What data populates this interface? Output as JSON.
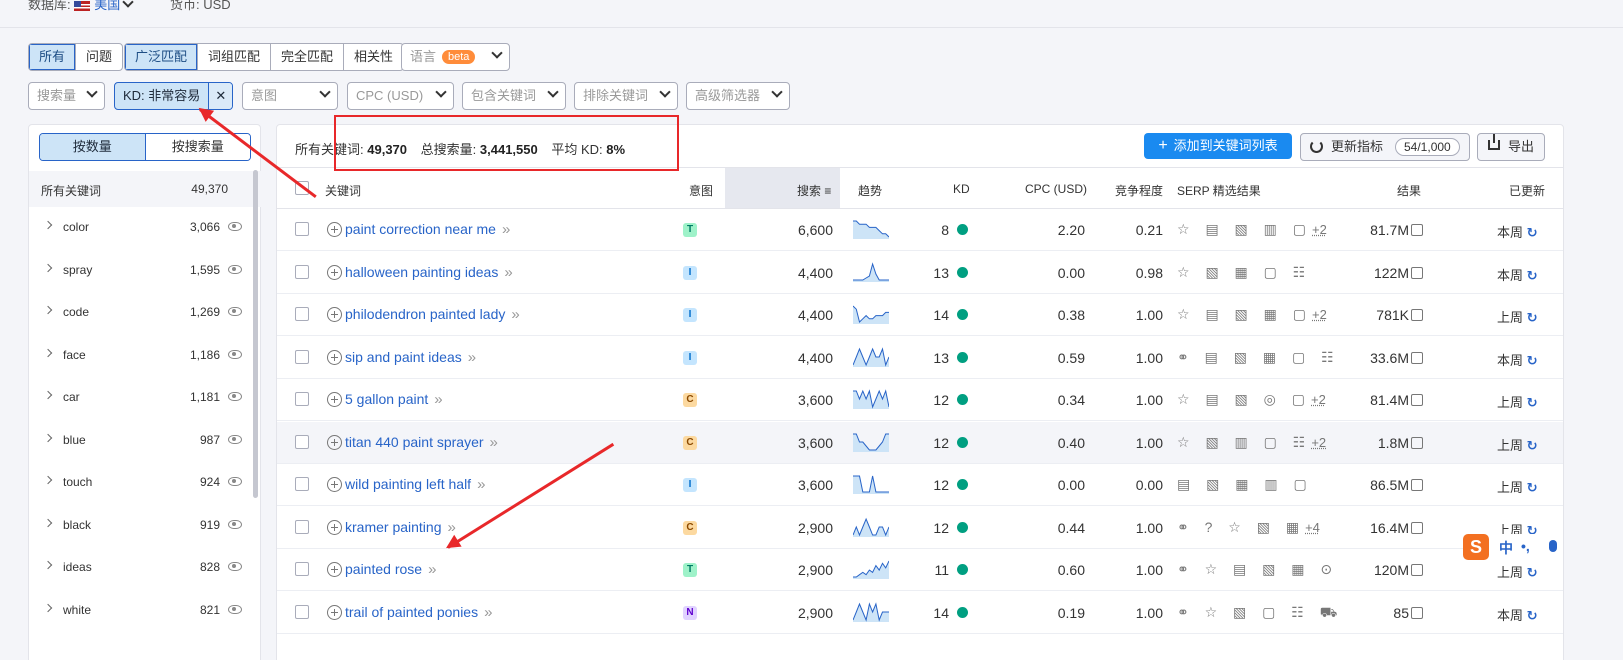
{
  "topbar": {
    "db_label": "数据库:",
    "db_value": "美国",
    "currency": "货币: USD"
  },
  "filters": {
    "type_tabs": [
      "所有",
      "问题"
    ],
    "match_tabs": [
      "广泛匹配",
      "词组匹配",
      "完全匹配",
      "相关性"
    ],
    "language_label": "语言",
    "language_badge": "beta",
    "volume": "搜索量",
    "kd_chip": "KD: 非常容易",
    "intent": "意图",
    "cpc": "CPC (USD)",
    "include": "包含关键词",
    "exclude": "排除关键词",
    "advanced": "高级筛选器"
  },
  "left_panel": {
    "toggle": [
      "按数量",
      "按搜索量"
    ],
    "header_label": "所有关键词",
    "header_count": "49,370",
    "groups": [
      {
        "label": "color",
        "count": "3,066"
      },
      {
        "label": "spray",
        "count": "1,595"
      },
      {
        "label": "code",
        "count": "1,269"
      },
      {
        "label": "face",
        "count": "1,186"
      },
      {
        "label": "car",
        "count": "1,181"
      },
      {
        "label": "blue",
        "count": "987"
      },
      {
        "label": "touch",
        "count": "924"
      },
      {
        "label": "black",
        "count": "919"
      },
      {
        "label": "ideas",
        "count": "828"
      },
      {
        "label": "white",
        "count": "821"
      }
    ]
  },
  "summary": {
    "all_label": "所有关键词:",
    "all_value": "49,370",
    "vol_label": "总搜索量:",
    "vol_value": "3,441,550",
    "kd_label": "平均 KD:",
    "kd_value": "8%"
  },
  "actions": {
    "add": "添加到关键词列表",
    "update": "更新指标",
    "update_count": "54/1,000",
    "export": "导出"
  },
  "table": {
    "headers": {
      "keyword": "关键词",
      "intent": "意图",
      "volume": "搜索",
      "trend": "趋势",
      "kd": "KD",
      "cpc": "CPC (USD)",
      "competition": "竞争程度",
      "serp": "SERP 精选结果",
      "results": "结果",
      "updated": "已更新"
    },
    "rows": [
      {
        "keyword": "paint correction near me",
        "intent": "T",
        "volume": "6,600",
        "kd": "8",
        "cpc": "2.20",
        "com": "0.21",
        "serp": "☆ ▤ ▧ ▥ ▢",
        "more": "+2",
        "results": "81.7M",
        "updated": "本周",
        "trend": [
          8,
          8,
          7,
          7,
          7,
          6,
          6,
          6,
          5,
          4,
          4,
          3
        ]
      },
      {
        "keyword": "halloween painting ideas",
        "intent": "I",
        "volume": "4,400",
        "kd": "13",
        "cpc": "0.00",
        "com": "0.98",
        "serp": "☆ ▧ ▦ ▢ ☷",
        "more": "",
        "results": "122M",
        "updated": "本周",
        "trend": [
          1,
          1,
          1,
          1,
          2,
          3,
          9,
          4,
          1,
          1,
          1,
          1
        ]
      },
      {
        "keyword": "philodendron painted lady",
        "intent": "I",
        "volume": "4,400",
        "kd": "14",
        "cpc": "0.38",
        "com": "1.00",
        "serp": "☆ ▤ ▧ ▦ ▢",
        "more": "+2",
        "results": "781K",
        "updated": "上周",
        "trend": [
          9,
          8,
          4,
          5,
          6,
          5,
          5,
          6,
          6,
          6,
          7,
          7
        ]
      },
      {
        "keyword": "sip and paint ideas",
        "intent": "I",
        "volume": "4,400",
        "kd": "13",
        "cpc": "0.59",
        "com": "1.00",
        "serp": "⚭ ▤ ▧ ▦ ▢ ☷",
        "more": "",
        "results": "33.6M",
        "updated": "本周",
        "trend": [
          4,
          5,
          6,
          5,
          4,
          5,
          6,
          5,
          5,
          6,
          4,
          5
        ]
      },
      {
        "keyword": "5 gallon paint",
        "intent": "C",
        "volume": "3,600",
        "kd": "12",
        "cpc": "0.34",
        "com": "1.00",
        "serp": "☆ ▤ ▧ ◎ ▢",
        "more": "+2",
        "results": "81.4M",
        "updated": "上周",
        "trend": [
          8,
          8,
          7,
          8,
          7,
          8,
          6,
          7,
          8,
          7,
          8,
          6
        ]
      },
      {
        "keyword": "titan 440 paint sprayer",
        "intent": "C",
        "volume": "3,600",
        "kd": "12",
        "cpc": "0.40",
        "com": "1.00",
        "serp": "☆ ▧ ▥ ▢ ☷",
        "more": "+2",
        "results": "1.8M",
        "updated": "上周",
        "trend": [
          9,
          9,
          7,
          7,
          6,
          5,
          5,
          5,
          6,
          7,
          9,
          9
        ]
      },
      {
        "keyword": "wild painting left half",
        "intent": "I",
        "volume": "3,600",
        "kd": "12",
        "cpc": "0.00",
        "com": "0.00",
        "serp": "▤ ▧ ▦ ▥ ▢",
        "more": "",
        "results": "86.5M",
        "updated": "上周",
        "trend": [
          3,
          3,
          3,
          2,
          2,
          2,
          3,
          2,
          2,
          2,
          2,
          2
        ]
      },
      {
        "keyword": "kramer painting",
        "intent": "C",
        "volume": "2,900",
        "kd": "12",
        "cpc": "0.44",
        "com": "1.00",
        "serp": "⚭ ? ☆ ▧ ▦",
        "more": "+4",
        "results": "16.4M",
        "updated": "上周",
        "trend": [
          4,
          5,
          4,
          5,
          6,
          5,
          4,
          4,
          5,
          5,
          4,
          5
        ]
      },
      {
        "keyword": "painted rose",
        "intent": "T",
        "volume": "2,900",
        "kd": "11",
        "cpc": "0.60",
        "com": "1.00",
        "serp": "⚭ ☆ ▤ ▧ ▦ ⊙",
        "more": "",
        "results": "120M",
        "updated": "上周",
        "trend": [
          2,
          2,
          3,
          4,
          3,
          5,
          4,
          7,
          5,
          8,
          6,
          9
        ]
      },
      {
        "keyword": "trail of painted ponies",
        "intent": "N",
        "volume": "2,900",
        "kd": "14",
        "cpc": "0.19",
        "com": "1.00",
        "serp": "⚭ ☆ ▧ ▢ ☷ ⛟",
        "more": "",
        "results": "85",
        "updated": "本周",
        "trend": [
          4,
          5,
          6,
          5,
          4,
          6,
          5,
          6,
          4,
          5,
          5,
          5
        ]
      }
    ]
  },
  "ime": {
    "logo": "S",
    "lang": "中",
    "punct": "•,"
  },
  "colors": {
    "accent": "#2864c8",
    "kd_easy": "#009f81",
    "annotation": "#e8282a"
  }
}
